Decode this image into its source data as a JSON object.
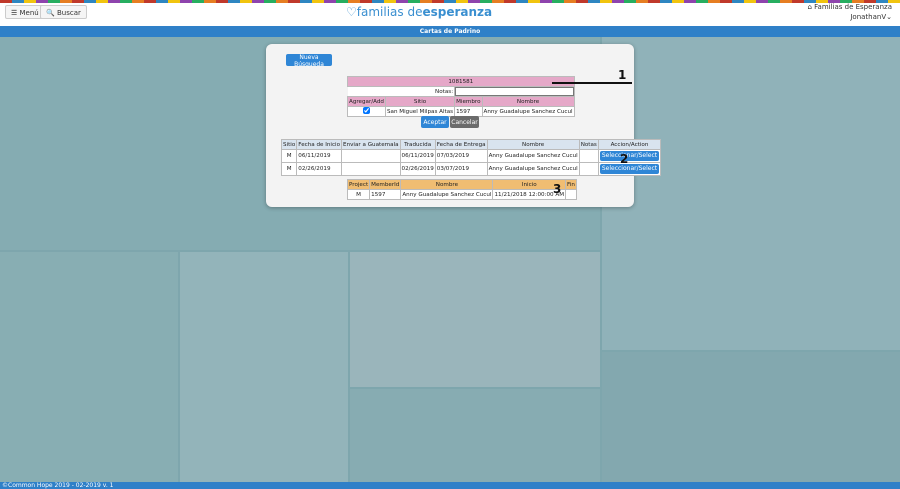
{
  "header": {
    "menu_label": "Menú",
    "search_label": "Buscar",
    "logo_light": "familias de",
    "logo_bold": "esperanza",
    "org_name": "Familias de Esperanza",
    "user_name": "JonathanV"
  },
  "page_title": "Cartas de Padrino",
  "footer": "©Common Hope 2019 - 02-2019 v. 1",
  "panel": {
    "new_search_label": "Nueva Búsqueda",
    "card": {
      "id": "1081581",
      "notes_label": "Notas:",
      "notes_value": "",
      "columns": [
        "Agregar/Add",
        "Sitio",
        "Miembro",
        "Nombre"
      ],
      "row": {
        "checked": true,
        "sitio": "San Miguel Milpas Altas",
        "miembro": "1597",
        "nombre": "Anny Guadalupe Sanchez Cucul"
      },
      "accept_label": "Aceptar",
      "cancel_label": "Cancelar"
    },
    "letters": {
      "columns": [
        "Sitio",
        "Fecha de Inicio",
        "Enviar a Guatemala",
        "Traducida",
        "Fecha de Entrega",
        "Nombre",
        "Notas",
        "Accion/Action"
      ],
      "rows": [
        {
          "sitio": "M",
          "inicio": "06/11/2019",
          "enviar": "",
          "traducida": "06/11/2019",
          "entrega": "07/03/2019",
          "nombre": "Anny Guadalupe Sanchez Cucul",
          "notas": "",
          "action": "Seleccionar/Select"
        },
        {
          "sitio": "M",
          "inicio": "02/26/2019",
          "enviar": "",
          "traducida": "02/26/2019",
          "entrega": "03/07/2019",
          "nombre": "Anny Guadalupe Sanchez Cucul",
          "notas": "",
          "action": "Seleccionar/Select"
        }
      ]
    },
    "projects": {
      "columns": [
        "Project",
        "MemberId",
        "Nombre",
        "Inicio",
        "Fin"
      ],
      "row": {
        "project": "M",
        "member": "1597",
        "nombre": "Anny Guadalupe Sanchez Cucul",
        "inicio": "11/21/2018 12:00:00 AM",
        "fin": ""
      }
    },
    "markers": [
      "1",
      "2",
      "3"
    ]
  },
  "colors": {
    "accent": "#2f80c8",
    "pink": "#e5a8c8",
    "orange": "#f0bd72"
  }
}
